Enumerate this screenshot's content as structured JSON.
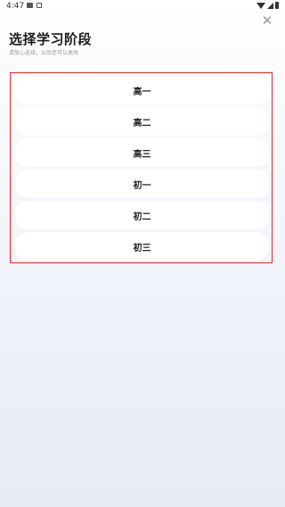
{
  "status_bar": {
    "time": "4:47",
    "icons": [
      "image-icon",
      "notification-icon",
      "wifi-icon",
      "signal-icon",
      "battery-icon"
    ]
  },
  "header": {
    "title": "选择学习阶段",
    "subtitle": "请放心选择，以后还可以更改",
    "close_label": "✕"
  },
  "stages": [
    {
      "label": "高一"
    },
    {
      "label": "高二"
    },
    {
      "label": "高三"
    },
    {
      "label": "初一"
    },
    {
      "label": "初二"
    },
    {
      "label": "初三"
    }
  ],
  "colors": {
    "highlight_border": "#e0252f",
    "title": "#1a1a1a",
    "subtitle": "#9a9a9a"
  }
}
